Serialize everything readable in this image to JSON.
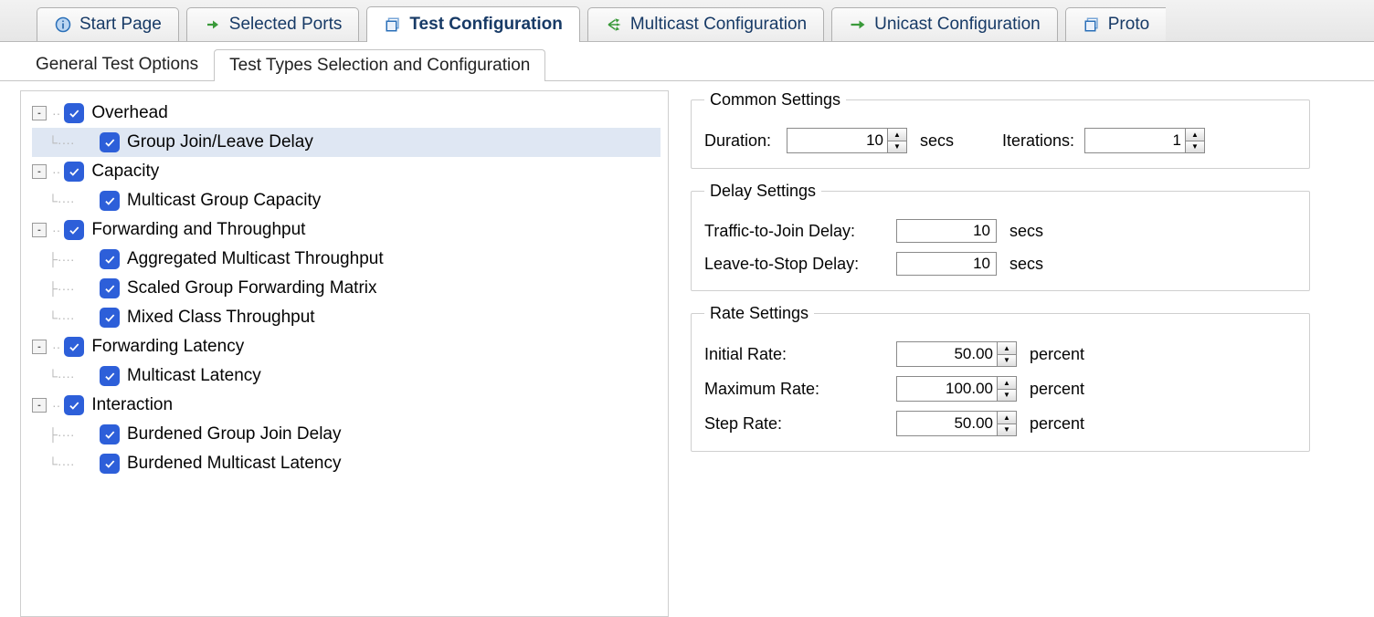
{
  "docTabs": [
    {
      "id": "start",
      "label": "Start Page"
    },
    {
      "id": "ports",
      "label": "Selected Ports"
    },
    {
      "id": "testcfg",
      "label": "Test Configuration"
    },
    {
      "id": "mcast",
      "label": "Multicast Configuration"
    },
    {
      "id": "ucast",
      "label": "Unicast Configuration"
    },
    {
      "id": "proto",
      "label": "Proto"
    }
  ],
  "activeDocTab": "testcfg",
  "subTabs": [
    {
      "id": "general",
      "label": "General Test Options"
    },
    {
      "id": "types",
      "label": "Test Types Selection and Configuration"
    }
  ],
  "activeSubTab": "types",
  "tree": [
    {
      "label": "Overhead",
      "depth": 0,
      "exp": "-"
    },
    {
      "label": "Group Join/Leave Delay",
      "depth": 1,
      "sel": true,
      "last": true
    },
    {
      "label": "Capacity",
      "depth": 0,
      "exp": "-"
    },
    {
      "label": "Multicast Group Capacity",
      "depth": 1,
      "last": true
    },
    {
      "label": "Forwarding and Throughput",
      "depth": 0,
      "exp": "-"
    },
    {
      "label": "Aggregated Multicast Throughput",
      "depth": 1
    },
    {
      "label": "Scaled Group Forwarding Matrix",
      "depth": 1
    },
    {
      "label": "Mixed Class Throughput",
      "depth": 1,
      "last": true
    },
    {
      "label": "Forwarding Latency",
      "depth": 0,
      "exp": "-"
    },
    {
      "label": "Multicast Latency",
      "depth": 1,
      "last": true
    },
    {
      "label": "Interaction",
      "depth": 0,
      "exp": "-"
    },
    {
      "label": "Burdened Group Join Delay",
      "depth": 1
    },
    {
      "label": "Burdened Multicast Latency",
      "depth": 1,
      "last": true
    }
  ],
  "common": {
    "legend": "Common Settings",
    "durationLabel": "Duration:",
    "durationValue": "10",
    "durationUnit": "secs",
    "iterationsLabel": "Iterations:",
    "iterationsValue": "1"
  },
  "delay": {
    "legend": "Delay Settings",
    "joinLabel": "Traffic-to-Join Delay:",
    "joinValue": "10",
    "joinUnit": "secs",
    "leaveLabel": "Leave-to-Stop Delay:",
    "leaveValue": "10",
    "leaveUnit": "secs"
  },
  "rate": {
    "legend": "Rate Settings",
    "initLabel": "Initial Rate:",
    "initValue": "50.00",
    "maxLabel": "Maximum Rate:",
    "maxValue": "100.00",
    "stepLabel": "Step Rate:",
    "stepValue": "50.00",
    "unit": "percent"
  }
}
